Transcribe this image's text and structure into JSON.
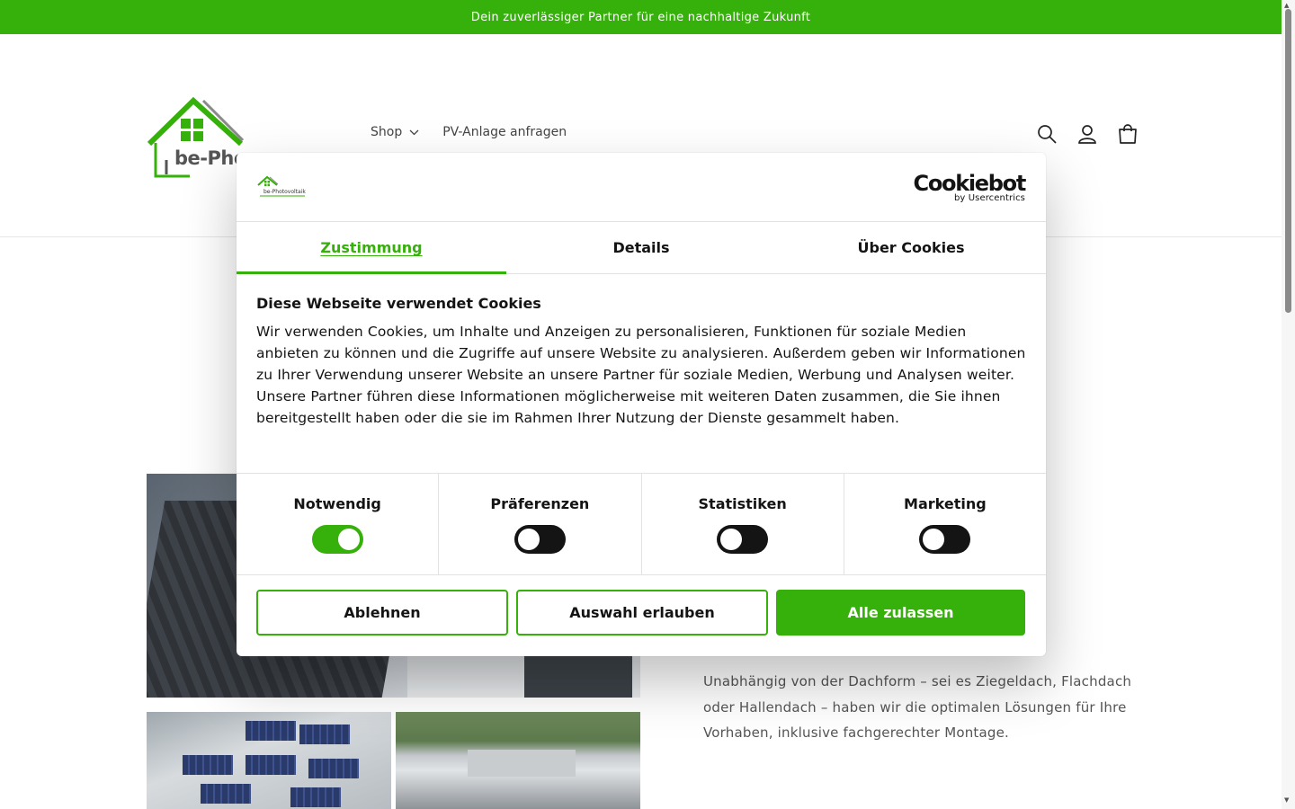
{
  "announcement": {
    "text": "Dein zuverlässiger Partner für eine nachhaltige Zukunft"
  },
  "brand": {
    "logo_text": "be-Pho",
    "brand_color": "#36b00a"
  },
  "nav": {
    "items": [
      {
        "label": "Shop",
        "has_dropdown": true
      },
      {
        "label": "PV-Anlage anfragen",
        "has_dropdown": false
      }
    ]
  },
  "header_icons": [
    "search-icon",
    "account-icon",
    "cart-icon"
  ],
  "page": {
    "body_text": "Unabhängig von der Dachform – sei es Ziegeldach, Flachdach oder Hallendach – haben wir die optimalen Lösungen für Ihre Vorhaben, inklusive fachgerechter Montage."
  },
  "cookie_modal": {
    "logo_caption": "be-Photovoltaik",
    "provider": {
      "name": "Cookiebot",
      "sub": "by Usercentrics"
    },
    "tabs": [
      {
        "label": "Zustimmung",
        "active": true
      },
      {
        "label": "Details",
        "active": false
      },
      {
        "label": "Über Cookies",
        "active": false
      }
    ],
    "heading": "Diese Webseite verwendet Cookies",
    "body": "Wir verwenden Cookies, um Inhalte und Anzeigen zu personalisieren, Funktionen für soziale Medien anbieten zu können und die Zugriffe auf unsere Website zu analysieren. Außerdem geben wir Informationen zu Ihrer Verwendung unserer Website an unsere Partner für soziale Medien, Werbung und Analysen weiter. Unsere Partner führen diese Informationen möglicherweise mit weiteren Daten zusammen, die Sie ihnen bereitgestellt haben oder die sie im Rahmen Ihrer Nutzung der Dienste gesammelt haben.",
    "toggles": [
      {
        "label": "Notwendig",
        "on": true
      },
      {
        "label": "Präferenzen",
        "on": false
      },
      {
        "label": "Statistiken",
        "on": false
      },
      {
        "label": "Marketing",
        "on": false
      }
    ],
    "buttons": {
      "reject": "Ablehnen",
      "allow_selection": "Auswahl erlauben",
      "allow_all": "Alle zulassen"
    }
  }
}
